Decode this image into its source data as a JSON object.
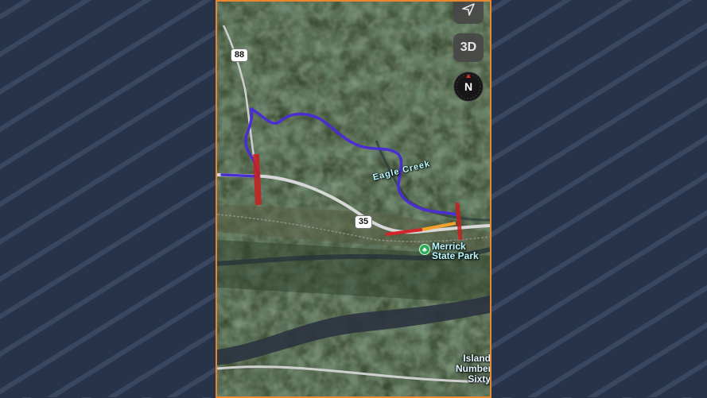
{
  "map": {
    "highway_88": "88",
    "highway_35": "35",
    "creek_label": "Eagle Creek",
    "park_label_line1": "Merrick",
    "park_label_line2": "State Park",
    "island_label_line1": "Island",
    "island_label_line2": "Number",
    "island_label_line3": "Sixty"
  },
  "controls": {
    "three_d_label": "3D",
    "compass_label": "N",
    "locate_icon": "location-arrow-icon",
    "park_icon": "tree-icon"
  },
  "colors": {
    "route": "#4a2ed1",
    "traffic_red": "#d4262a",
    "traffic_orange": "#f2a12b",
    "frame_border": "#e9862e"
  }
}
